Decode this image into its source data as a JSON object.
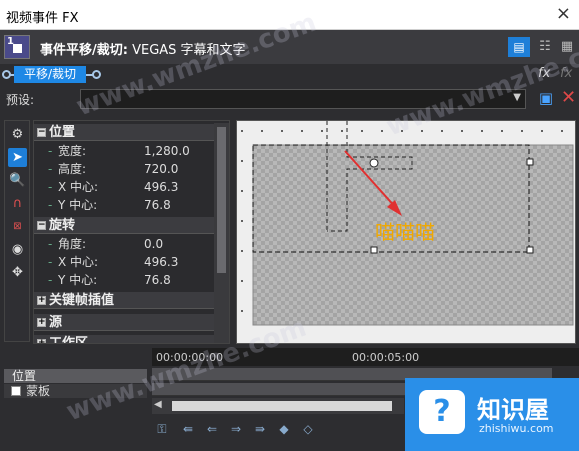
{
  "window": {
    "title": "视频事件 FX",
    "close": "×"
  },
  "header": {
    "plugin_chain": "事件平移/裁切:",
    "plugin_name": "VEGAS 字幕和文字",
    "view_icon": "list-view-icon"
  },
  "pipeline": {
    "active_plugin": "平移/裁切"
  },
  "preset": {
    "label": "预设:",
    "value": ""
  },
  "properties": {
    "position": {
      "title": "位置",
      "rows": [
        {
          "key": "宽度:",
          "value": "1,280.0"
        },
        {
          "key": "高度:",
          "value": "720.0"
        },
        {
          "key": "X 中心:",
          "value": "496.3"
        },
        {
          "key": "Y 中心:",
          "value": "76.8"
        }
      ]
    },
    "rotation": {
      "title": "旋转",
      "rows": [
        {
          "key": "角度:",
          "value": "0.0"
        },
        {
          "key": "X 中心:",
          "value": "496.3"
        },
        {
          "key": "Y 中心:",
          "value": "76.8"
        }
      ]
    },
    "keyframe_interp": "关键帧插值",
    "source": "源",
    "workspace": "工作区"
  },
  "canvas": {
    "caption": "喵喵喵"
  },
  "timeline": {
    "ruler": {
      "t0": "00:00:00:00",
      "t1": "00:00:05:00"
    },
    "tracks": [
      {
        "label": "位置"
      },
      {
        "label": "蒙板"
      }
    ]
  },
  "watermark": {
    "brand": "知识屋",
    "url": "zhishiwu.com",
    "site": "www.wmzhe.com"
  },
  "colors": {
    "accent": "#1e7fd8",
    "caption": "#f0a800",
    "arrow": "#e03030"
  }
}
